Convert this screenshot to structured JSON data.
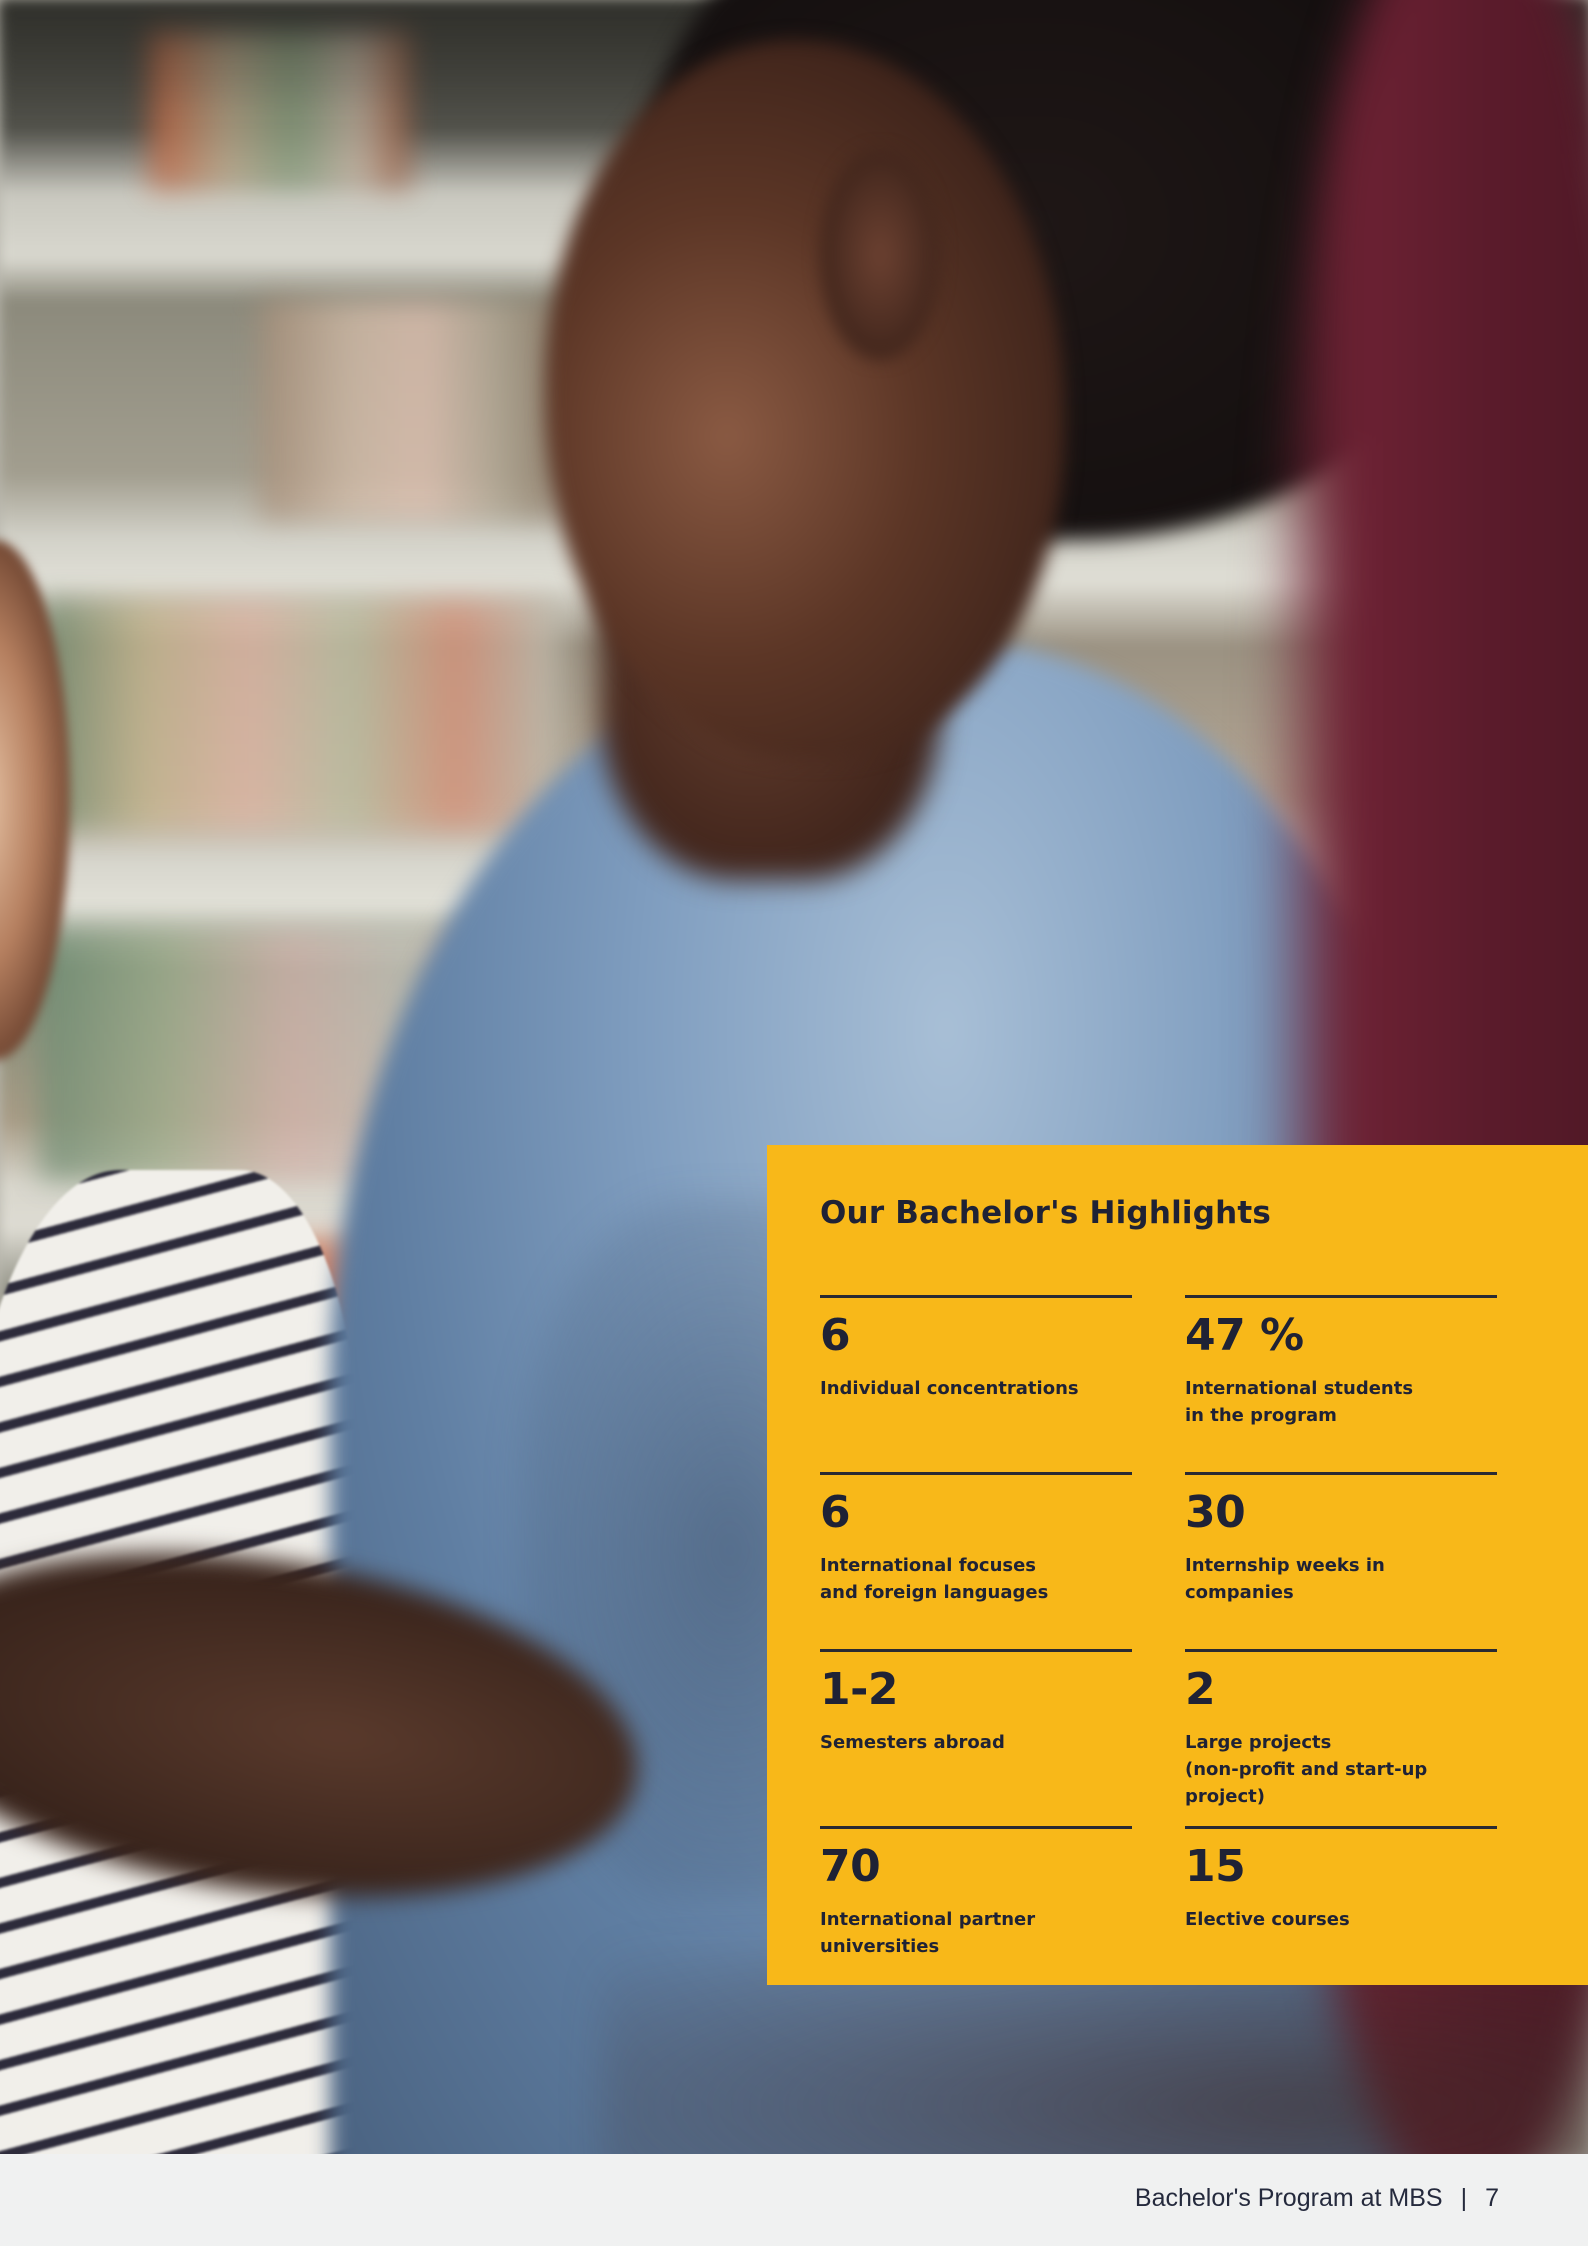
{
  "panel": {
    "title": "Our Bachelor's Highlights",
    "background_color": "#f8b819",
    "text_color": "#1f2235",
    "stats": [
      {
        "value": "6",
        "label": "Individual concentrations"
      },
      {
        "value": "47 %",
        "label": "International students\nin the program"
      },
      {
        "value": "6",
        "label": "International focuses\nand foreign languages"
      },
      {
        "value": "30",
        "label": "Internship weeks in companies"
      },
      {
        "value": "1-2",
        "label": "Semesters abroad"
      },
      {
        "value": "2",
        "label": "Large projects\n(non-profit and start-up project)"
      },
      {
        "value": "70",
        "label": "International partner universities"
      },
      {
        "value": "15",
        "label": "Elective courses"
      }
    ]
  },
  "footer": {
    "document_title": "Bachelor's Program at MBS",
    "separator": "|",
    "page_number": "7"
  }
}
